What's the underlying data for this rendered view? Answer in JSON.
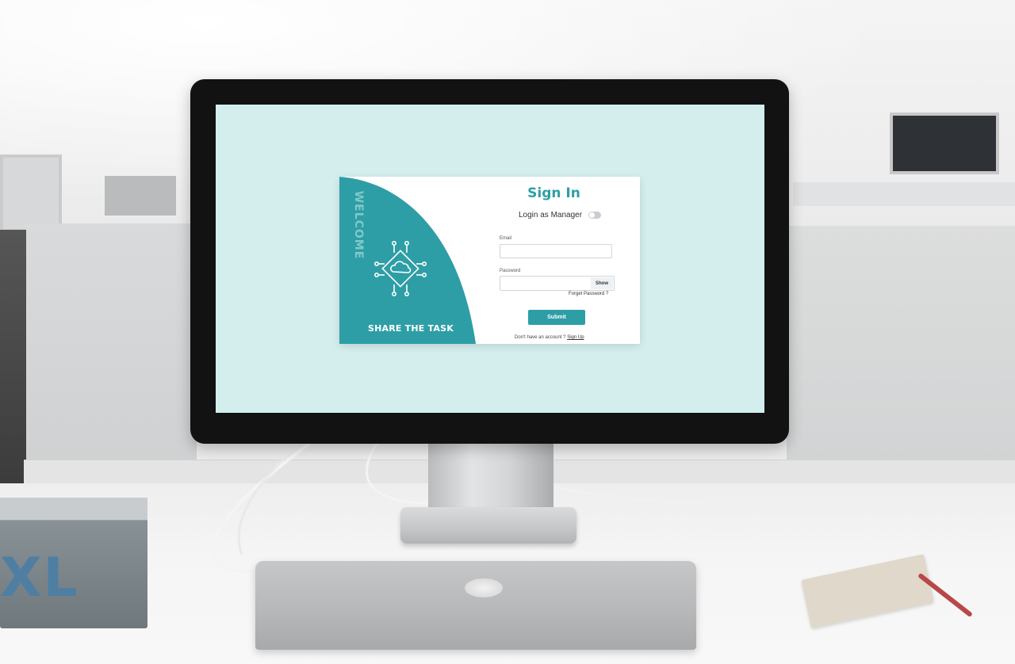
{
  "colors": {
    "accent": "#2e9ea6",
    "screen_background": "#d4eeee",
    "welcome_text": "#7fc9ca"
  },
  "left_panel": {
    "welcome": "WELCOME",
    "tagline": "SHARE THE TASK",
    "icon": "cloud-circuit-icon"
  },
  "sign_in": {
    "title": "Sign In",
    "manager_toggle_label": "Login as Manager",
    "manager_toggle_on": false,
    "email_label": "Email",
    "email_value": "",
    "password_label": "Password",
    "password_value": "",
    "show_label": "Show",
    "forgot_label": "Forget Password ?",
    "submit_label": "Submit",
    "no_account_text": "Don't have an account ?",
    "signup_label": "Sign Up"
  },
  "scene": {
    "book_label": "XL"
  }
}
